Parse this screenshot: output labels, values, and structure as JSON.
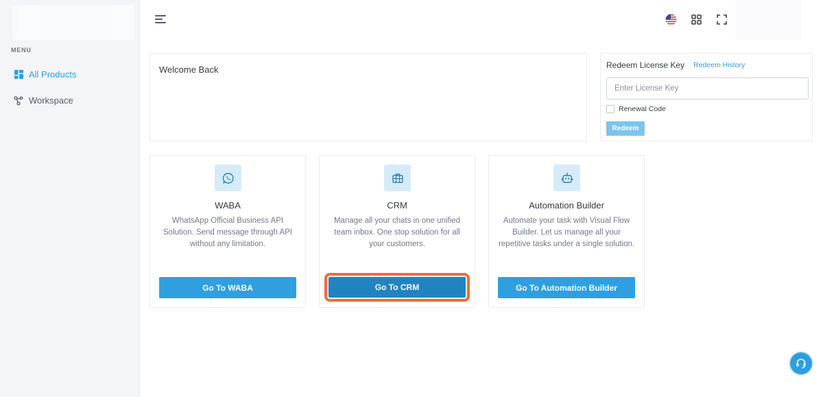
{
  "sidebar": {
    "menu_title": "MENU",
    "items": [
      {
        "label": "All Products",
        "icon": "grid-icon",
        "active": true
      },
      {
        "label": "Workspace",
        "icon": "network-icon",
        "active": false
      }
    ]
  },
  "topbar": {
    "icons": [
      "menu-icon",
      "us-flag-icon",
      "apps-grid-icon",
      "fullscreen-icon"
    ]
  },
  "welcome": {
    "title": "Welcome Back"
  },
  "redeem": {
    "title": "Redeem License Key",
    "history_link": "Redeem History",
    "input_placeholder": "Enter License Key",
    "input_value": "",
    "checkbox_label": "Renewal Code",
    "checkbox_checked": false,
    "button_label": "Redeem"
  },
  "products": [
    {
      "title": "WABA",
      "icon": "whatsapp-icon",
      "description": "WhatsApp Official Business API Solution. Send message through API without any limitation.",
      "button": "Go To WABA"
    },
    {
      "title": "CRM",
      "icon": "briefcase-icon",
      "description": "Manage all your chats in one unified team inbox. One stop solution for all your customers.",
      "button": "Go To CRM"
    },
    {
      "title": "Automation Builder",
      "icon": "robot-icon",
      "description": "Automate your task with Visual Flow Builder. Let us manage all your repetitive tasks under a single solution.",
      "button": "Go To Automation Builder"
    }
  ],
  "colors": {
    "accent": "#2f9fe0",
    "focus_ring": "#f06b3b",
    "sidebar_bg": "#f4f5f8"
  }
}
